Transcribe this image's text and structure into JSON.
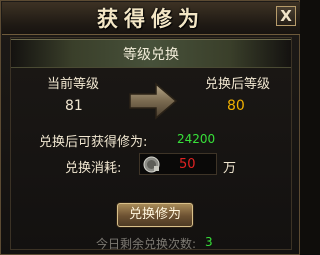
{
  "window": {
    "title": "获得修为",
    "close_label": "X"
  },
  "banner": {
    "label": "等级兑换"
  },
  "levels": {
    "current_label": "当前等级",
    "current_value": "81",
    "after_label": "兑换后等级",
    "after_value": "80"
  },
  "gain": {
    "label": "兑换后可获得修为:",
    "value": "24200"
  },
  "cost": {
    "label": "兑换消耗:",
    "value": "50",
    "unit": "万"
  },
  "action": {
    "button_label": "兑换修为"
  },
  "remaining": {
    "label": "今日剩余兑换次数:",
    "value": "3"
  },
  "colors": {
    "green_value": "#37e039",
    "red_value": "#e02222",
    "gold_value": "#f0b000"
  }
}
